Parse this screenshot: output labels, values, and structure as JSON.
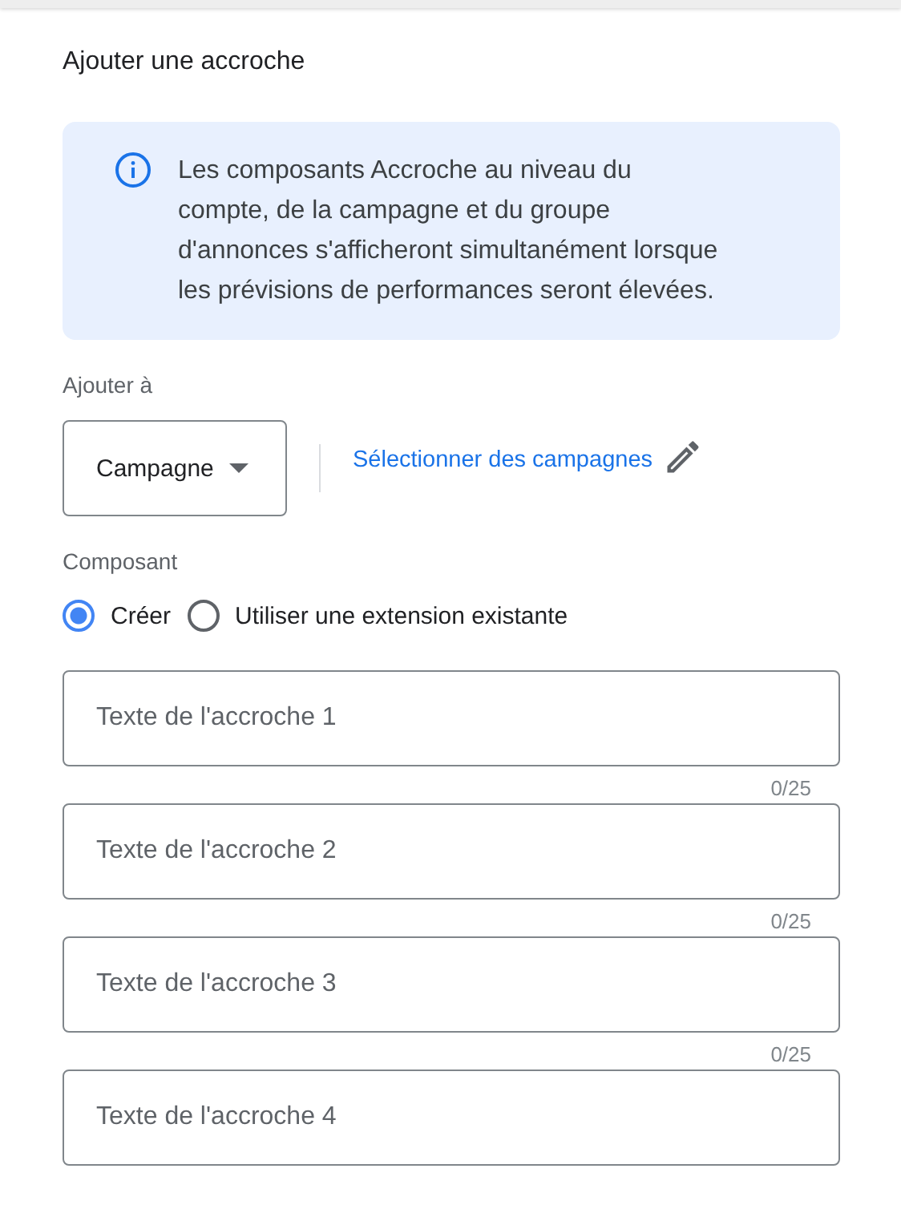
{
  "title": "Ajouter une accroche",
  "info": {
    "text": "Les composants Accroche au niveau du compte, de la campagne et du groupe d'annonces s'afficheront simultanément lorsque les prévisions de performances seront élevées."
  },
  "add_to": {
    "label": "Ajouter à",
    "dropdown": "Campagne",
    "link": "Sélectionner des campagnes"
  },
  "component": {
    "label": "Composant",
    "options": [
      {
        "label": "Créer",
        "selected": true
      },
      {
        "label": "Utiliser une extension existante",
        "selected": false
      }
    ]
  },
  "fields": [
    {
      "placeholder": "Texte de l'accroche 1",
      "counter": "0/25"
    },
    {
      "placeholder": "Texte de l'accroche 2",
      "counter": "0/25"
    },
    {
      "placeholder": "Texte de l'accroche 3",
      "counter": "0/25"
    },
    {
      "placeholder": "Texte de l'accroche 4"
    }
  ]
}
